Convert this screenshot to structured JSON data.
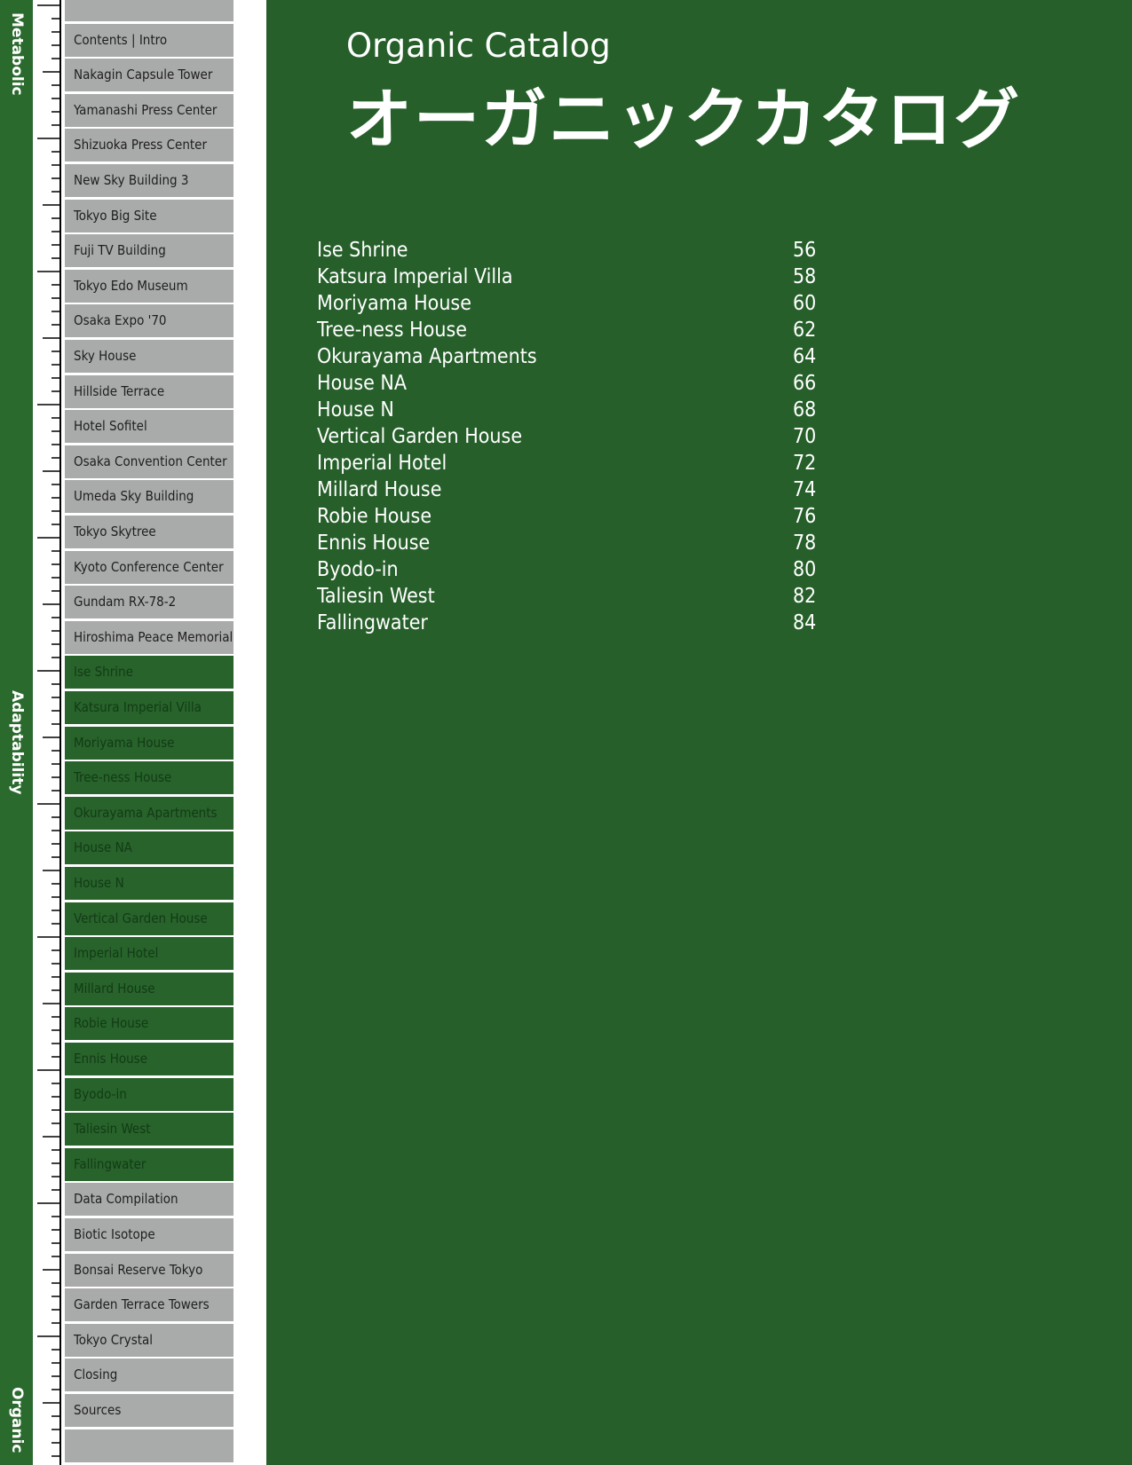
{
  "sidebar": {
    "section_labels": {
      "top": "Metabolic",
      "middle": "Adaptability",
      "bottom": "Organic"
    },
    "tabs": [
      {
        "label": "",
        "state": "grey"
      },
      {
        "label": "Contents | Intro",
        "state": "grey"
      },
      {
        "label": "Nakagin Capsule Tower",
        "state": "grey"
      },
      {
        "label": "Yamanashi Press Center",
        "state": "grey"
      },
      {
        "label": "Shizuoka Press Center",
        "state": "grey"
      },
      {
        "label": "New Sky Building 3",
        "state": "grey"
      },
      {
        "label": "Tokyo Big Site",
        "state": "grey"
      },
      {
        "label": "Fuji TV Building",
        "state": "grey"
      },
      {
        "label": "Tokyo Edo Museum",
        "state": "grey"
      },
      {
        "label": "Osaka Expo '70",
        "state": "grey"
      },
      {
        "label": "Sky House",
        "state": "grey"
      },
      {
        "label": "Hillside Terrace",
        "state": "grey"
      },
      {
        "label": "Hotel Sofitel",
        "state": "grey"
      },
      {
        "label": "Osaka Convention Center",
        "state": "grey"
      },
      {
        "label": "Umeda Sky Building",
        "state": "grey"
      },
      {
        "label": "Tokyo Skytree",
        "state": "grey"
      },
      {
        "label": "Kyoto Conference Center",
        "state": "grey"
      },
      {
        "label": "Gundam RX-78-2",
        "state": "grey"
      },
      {
        "label": "Hiroshima Peace Memorial",
        "state": "grey"
      },
      {
        "label": "Ise Shrine",
        "state": "green"
      },
      {
        "label": "Katsura Imperial Villa",
        "state": "green"
      },
      {
        "label": "Moriyama House",
        "state": "green"
      },
      {
        "label": "Tree-ness House",
        "state": "green"
      },
      {
        "label": "Okurayama Apartments",
        "state": "green"
      },
      {
        "label": "House NA",
        "state": "green"
      },
      {
        "label": "House N",
        "state": "green"
      },
      {
        "label": "Vertical Garden House",
        "state": "green"
      },
      {
        "label": "Imperial Hotel",
        "state": "green"
      },
      {
        "label": "Millard House",
        "state": "green"
      },
      {
        "label": "Robie House",
        "state": "green"
      },
      {
        "label": "Ennis House",
        "state": "green"
      },
      {
        "label": "Byodo-in",
        "state": "green"
      },
      {
        "label": "Taliesin West",
        "state": "green"
      },
      {
        "label": "Fallingwater",
        "state": "green"
      },
      {
        "label": "Data Compilation",
        "state": "grey"
      },
      {
        "label": "Biotic Isotope",
        "state": "grey"
      },
      {
        "label": "Bonsai Reserve Tokyo",
        "state": "grey"
      },
      {
        "label": "Garden Terrace Towers",
        "state": "grey"
      },
      {
        "label": "Tokyo Crystal",
        "state": "grey"
      },
      {
        "label": "Closing",
        "state": "grey"
      },
      {
        "label": "Sources",
        "state": "grey"
      },
      {
        "label": "",
        "state": "grey"
      }
    ]
  },
  "header": {
    "title_en": "Organic Catalog",
    "title_jp": "オーガニックカタログ"
  },
  "toc": [
    {
      "name": "Ise Shrine",
      "page": "56"
    },
    {
      "name": "Katsura Imperial Villa",
      "page": "58"
    },
    {
      "name": "Moriyama House",
      "page": "60"
    },
    {
      "name": "Tree-ness House",
      "page": "62"
    },
    {
      "name": "Okurayama Apartments",
      "page": "64"
    },
    {
      "name": "House NA",
      "page": "66"
    },
    {
      "name": "House N",
      "page": "68"
    },
    {
      "name": "Vertical Garden House",
      "page": "70"
    },
    {
      "name": "Imperial Hotel",
      "page": "72"
    },
    {
      "name": "Millard House",
      "page": "74"
    },
    {
      "name": "Robie House",
      "page": "76"
    },
    {
      "name": "Ennis House",
      "page": "78"
    },
    {
      "name": "Byodo-in",
      "page": "80"
    },
    {
      "name": "Taliesin West",
      "page": "82"
    },
    {
      "name": "Fallingwater",
      "page": "84"
    }
  ],
  "colors": {
    "main_green": "#265f2a",
    "tab_grey": "#a9abaa",
    "tab_green": "#27632a",
    "strip_green": "#2a6a2d"
  }
}
